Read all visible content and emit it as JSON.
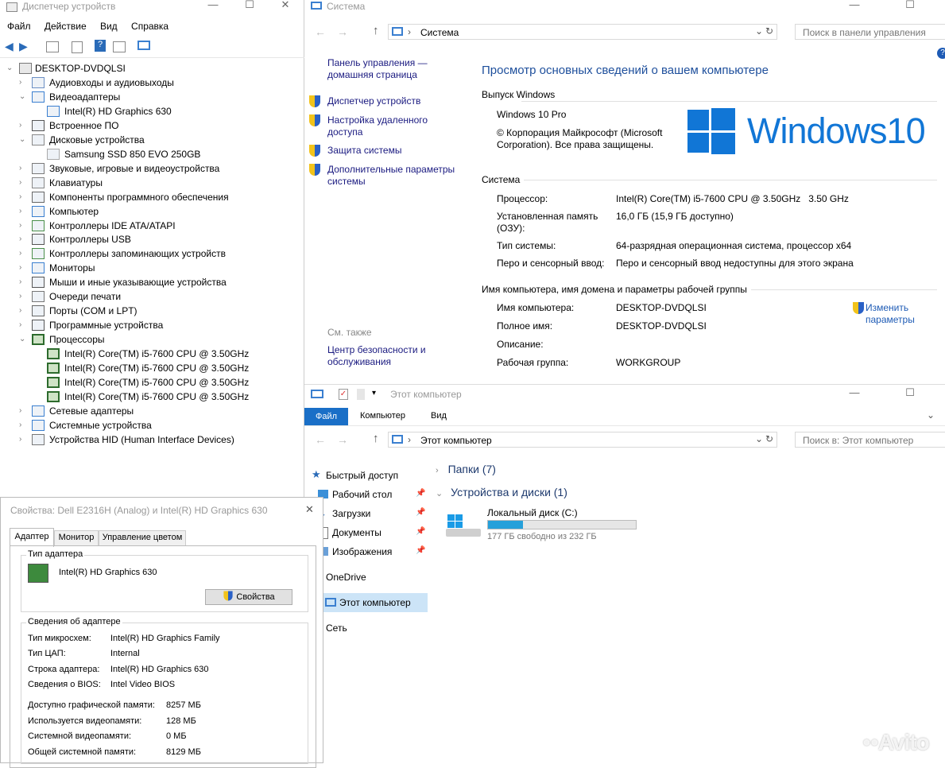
{
  "device_manager": {
    "title": "Диспетчер устройств",
    "menu": [
      "Файл",
      "Действие",
      "Вид",
      "Справка"
    ],
    "root": "DESKTOP-DVDQLSI",
    "tree": [
      {
        "label": "Аудиовходы и аудиовыходы",
        "level": 1,
        "expanded": false
      },
      {
        "label": "Видеоадаптеры",
        "level": 1,
        "expanded": true
      },
      {
        "label": "Intel(R) HD Graphics 630",
        "level": 2
      },
      {
        "label": "Встроенное ПО",
        "level": 1,
        "expanded": false
      },
      {
        "label": "Дисковые устройства",
        "level": 1,
        "expanded": true
      },
      {
        "label": "Samsung SSD 850 EVO 250GB",
        "level": 2
      },
      {
        "label": "Звуковые, игровые и видеоустройства",
        "level": 1,
        "expanded": false
      },
      {
        "label": "Клавиатуры",
        "level": 1,
        "expanded": false
      },
      {
        "label": "Компоненты программного обеспечения",
        "level": 1,
        "expanded": false
      },
      {
        "label": "Компьютер",
        "level": 1,
        "expanded": false
      },
      {
        "label": "Контроллеры IDE ATA/ATAPI",
        "level": 1,
        "expanded": false
      },
      {
        "label": "Контроллеры USB",
        "level": 1,
        "expanded": false
      },
      {
        "label": "Контроллеры запоминающих устройств",
        "level": 1,
        "expanded": false
      },
      {
        "label": "Мониторы",
        "level": 1,
        "expanded": false
      },
      {
        "label": "Мыши и иные указывающие устройства",
        "level": 1,
        "expanded": false
      },
      {
        "label": "Очереди печати",
        "level": 1,
        "expanded": false
      },
      {
        "label": "Порты (COM и LPT)",
        "level": 1,
        "expanded": false
      },
      {
        "label": "Программные устройства",
        "level": 1,
        "expanded": false
      },
      {
        "label": "Процессоры",
        "level": 1,
        "expanded": true
      },
      {
        "label": "Intel(R) Core(TM) i5-7600 CPU @ 3.50GHz",
        "level": 2
      },
      {
        "label": "Intel(R) Core(TM) i5-7600 CPU @ 3.50GHz",
        "level": 2
      },
      {
        "label": "Intel(R) Core(TM) i5-7600 CPU @ 3.50GHz",
        "level": 2
      },
      {
        "label": "Intel(R) Core(TM) i5-7600 CPU @ 3.50GHz",
        "level": 2
      },
      {
        "label": "Сетевые адаптеры",
        "level": 1,
        "expanded": false
      },
      {
        "label": "Системные устройства",
        "level": 1,
        "expanded": false
      },
      {
        "label": "Устройства HID (Human Interface Devices)",
        "level": 1,
        "expanded": false
      }
    ]
  },
  "system": {
    "title": "Система",
    "address": "Система",
    "search_placeholder": "Поиск в панели управления",
    "nav_home": "Панель управления — домашняя страница",
    "nav_links": [
      "Диспетчер устройств",
      "Настройка удаленного доступа",
      "Защита системы",
      "Дополнительные параметры системы"
    ],
    "see_also": "См. также",
    "see_also_link": "Центр безопасности и обслуживания",
    "heading": "Просмотр основных сведений о вашем компьютере",
    "edition_header": "Выпуск Windows",
    "edition": "Windows 10 Pro",
    "copyright": "© Корпорация Майкрософт (Microsoft Corporation). Все права защищены.",
    "logo_text": "Windows10",
    "system_header": "Система",
    "system_rows": [
      {
        "label": "Процессор:",
        "value": "Intel(R) Core(TM) i5-7600 CPU @ 3.50GHz   3.50 GHz"
      },
      {
        "label": "Установленная память (ОЗУ):",
        "value": "16,0 ГБ (15,9 ГБ доступно)"
      },
      {
        "label": "Тип системы:",
        "value": "64-разрядная операционная система, процессор x64"
      },
      {
        "label": "Перо и сенсорный ввод:",
        "value": "Перо и сенсорный ввод недоступны для этого экрана"
      }
    ],
    "name_header": "Имя компьютера, имя домена и параметры рабочей группы",
    "name_rows": [
      {
        "label": "Имя компьютера:",
        "value": "DESKTOP-DVDQLSI"
      },
      {
        "label": "Полное имя:",
        "value": "DESKTOP-DVDQLSI"
      },
      {
        "label": "Описание:",
        "value": ""
      },
      {
        "label": "Рабочая группа:",
        "value": "WORKGROUP"
      }
    ],
    "change_link": "Изменить параметры",
    "help": "?"
  },
  "explorer": {
    "title": "Этот компьютер",
    "tabs": [
      "Файл",
      "Компьютер",
      "Вид"
    ],
    "address": "Этот компьютер",
    "search_placeholder": "Поиск в: Этот компьютер",
    "nav": [
      "Быстрый доступ",
      "Рабочий стол",
      "Загрузки",
      "Документы",
      "Изображения",
      "OneDrive",
      "Этот компьютер",
      "Сеть"
    ],
    "folders_header": "Папки (7)",
    "devices_header": "Устройства и диски (1)",
    "drive_name": "Локальный диск (C:)",
    "drive_free": "177 ГБ свободно из 232 ГБ",
    "drive_used_fraction": 0.237
  },
  "properties": {
    "title": "Свойства: Dell E2316H (Analog) и Intel(R) HD Graphics 630",
    "tabs": [
      "Адаптер",
      "Монитор",
      "Управление цветом"
    ],
    "adapter_type_header": "Тип адаптера",
    "adapter_name": "Intel(R) HD Graphics 630",
    "properties_button": "Свойства",
    "info_header": "Сведения об адаптере",
    "info_rows": [
      {
        "label": "Тип микросхем:",
        "value": "Intel(R) HD Graphics Family"
      },
      {
        "label": "Тип ЦАП:",
        "value": "Internal"
      },
      {
        "label": "Строка адаптера:",
        "value": "Intel(R) HD Graphics 630"
      },
      {
        "label": "Сведения о BIOS:",
        "value": "Intel Video BIOS"
      }
    ],
    "memory_rows": [
      {
        "label": "Доступно графической памяти:",
        "value": "8257 МБ"
      },
      {
        "label": "Используется видеопамяти:",
        "value": "128 МБ"
      },
      {
        "label": "Системной видеопамяти:",
        "value": "0 МБ"
      },
      {
        "label": "Общей системной памяти:",
        "value": "8129 МБ"
      }
    ]
  },
  "watermark": "Avito"
}
